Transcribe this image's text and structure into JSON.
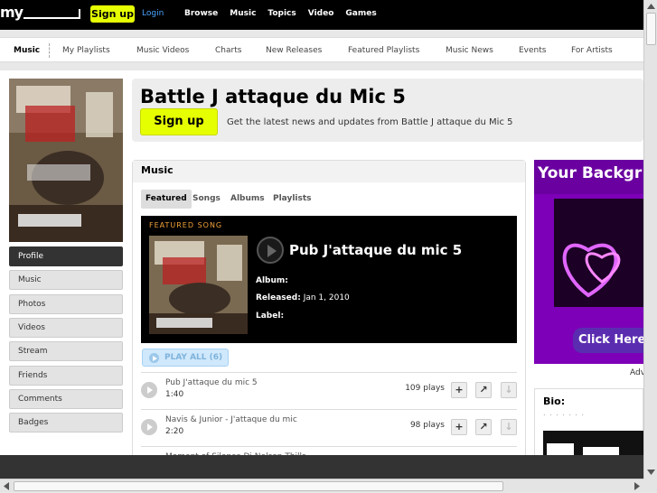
{
  "topbar": {
    "logo": "my",
    "signup_label": "Sign up",
    "login_label": "Login",
    "nav": [
      "Browse",
      "Music",
      "Topics",
      "Video",
      "Games"
    ]
  },
  "subnav": {
    "items": [
      "Music",
      "My Playlists",
      "Music Videos",
      "Charts",
      "New Releases",
      "Featured Playlists",
      "Music News",
      "Events",
      "For Artists"
    ]
  },
  "artist": {
    "name": "Battle J attaque du Mic 5",
    "signup_label": "Sign up",
    "signup_text": "Get the latest news and updates from Battle J attaque du Mic 5"
  },
  "sidebar": {
    "items": [
      "Profile",
      "Music",
      "Photos",
      "Videos",
      "Stream",
      "Friends",
      "Comments",
      "Badges"
    ]
  },
  "music": {
    "title": "Music",
    "tabs": [
      "Featured",
      "Songs",
      "Albums",
      "Playlists"
    ],
    "featured_label": "FEATURED SONG",
    "featured_song": {
      "title": "Pub J'attaque du mic 5",
      "album_label": "Album:",
      "album_value": "",
      "released_label": "Released:",
      "released_value": "Jan 1, 2010",
      "label_label": "Label:",
      "label_value": ""
    },
    "play_all": "PLAY ALL (6)",
    "tracks": [
      {
        "name": "Pub J'attaque du mic 5",
        "duration": "1:40",
        "plays": "109 plays"
      },
      {
        "name": "Navis & Junior - J'attaque du mic",
        "duration": "2:20",
        "plays": "98 plays"
      },
      {
        "name": "Moment of Silence Dj Nelson Thills",
        "duration": "",
        "plays": ""
      }
    ]
  },
  "right": {
    "ad_headline": "Your Backgr",
    "ad_click": "Click Here",
    "adv_label": "Adv",
    "bio_title": "Bio:",
    "bio_text": ". . . . . . ."
  },
  "colors": {
    "accent_yellow": "#e6ff00",
    "featured_orange": "#f2a13a",
    "ad_purple": "#8c00c8",
    "login_blue": "#4aa3ff"
  }
}
